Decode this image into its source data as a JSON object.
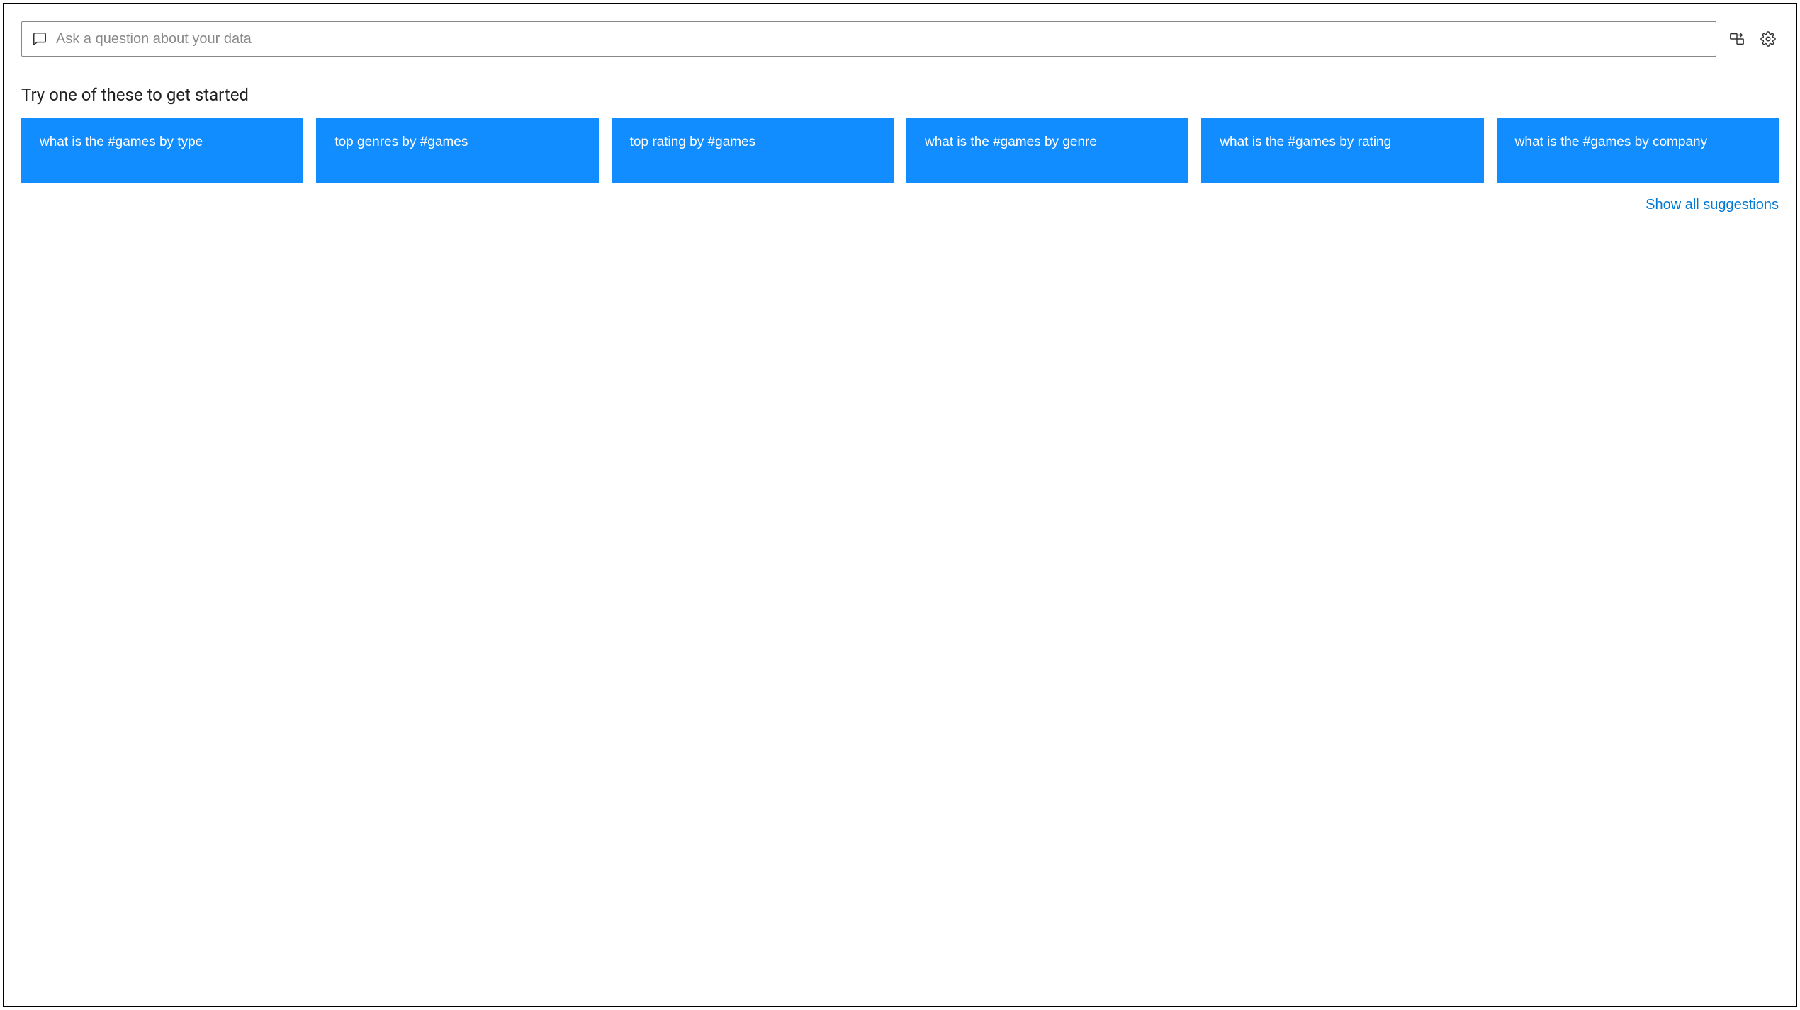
{
  "search": {
    "placeholder": "Ask a question about your data"
  },
  "section": {
    "title": "Try one of these to get started"
  },
  "suggestions": {
    "items": [
      {
        "label": "what is the #games by type"
      },
      {
        "label": "top genres by #games"
      },
      {
        "label": "top rating by #games"
      },
      {
        "label": "what is the #games by genre"
      },
      {
        "label": "what is the #games by rating"
      },
      {
        "label": "what is the #games by company"
      }
    ],
    "show_all_label": "Show all suggestions"
  },
  "colors": {
    "card_bg": "#118dff",
    "link": "#0078d4"
  }
}
